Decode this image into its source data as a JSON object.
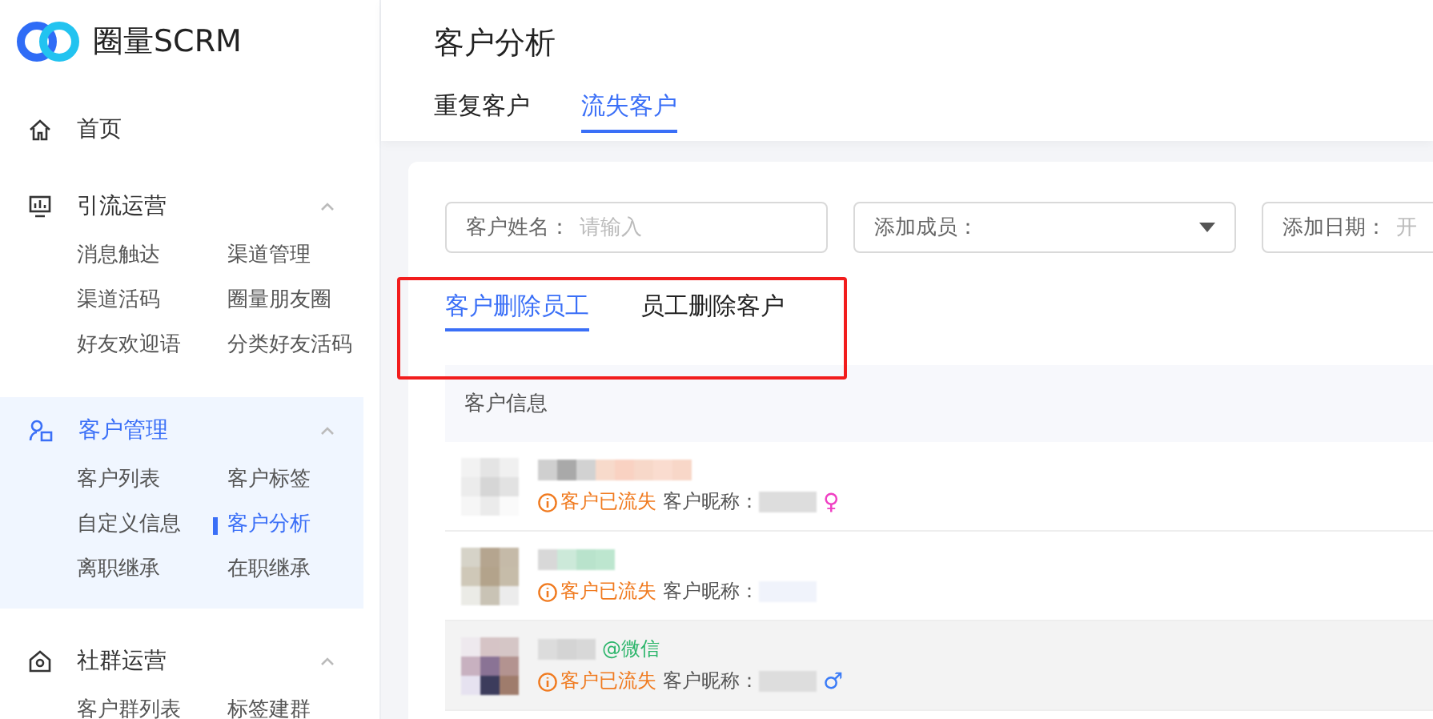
{
  "brand": {
    "name": "圈量SCRM"
  },
  "sidebar": {
    "groups": [
      {
        "label": "首页",
        "selected": false
      },
      {
        "label": "引流运营",
        "expanded": true,
        "selected": false,
        "children": [
          {
            "label": "消息触达",
            "selected": false
          },
          {
            "label": "渠道管理",
            "selected": false
          },
          {
            "label": "渠道活码",
            "selected": false
          },
          {
            "label": "圈量朋友圈",
            "selected": false
          },
          {
            "label": "好友欢迎语",
            "selected": false
          },
          {
            "label": "分类好友活码",
            "selected": false
          }
        ]
      },
      {
        "label": "客户管理",
        "expanded": true,
        "selected": true,
        "children": [
          {
            "label": "客户列表",
            "selected": false
          },
          {
            "label": "客户标签",
            "selected": false
          },
          {
            "label": "自定义信息",
            "selected": false
          },
          {
            "label": "客户分析",
            "selected": true
          },
          {
            "label": "离职继承",
            "selected": false
          },
          {
            "label": "在职继承",
            "selected": false
          }
        ]
      },
      {
        "label": "社群运营",
        "expanded": true,
        "selected": false,
        "children": [
          {
            "label": "客户群列表",
            "selected": false
          },
          {
            "label": "标签建群",
            "selected": false
          }
        ]
      }
    ]
  },
  "page": {
    "title": "客户分析",
    "tabs": [
      {
        "label": "重复客户",
        "selected": false
      },
      {
        "label": "流失客户",
        "selected": true
      }
    ]
  },
  "filters": [
    {
      "kind": "input",
      "label": "客户姓名：",
      "placeholder": "请输入"
    },
    {
      "kind": "select",
      "label": "添加成员："
    },
    {
      "kind": "date",
      "label": "添加日期：",
      "placeholder": "开"
    }
  ],
  "sub_tabs": [
    {
      "label": "客户删除员工",
      "selected": true
    },
    {
      "label": "员工删除客户",
      "selected": false
    }
  ],
  "annotation": {
    "shown": true
  },
  "table": {
    "columns": [
      "客户信息"
    ],
    "rows": [
      {
        "hovered": false,
        "status": "客户已流失",
        "nickname_label": "客户昵称：",
        "gender": {
          "mark": "♀",
          "color": "#f03fc3"
        }
      },
      {
        "hovered": false,
        "status": "客户已流失",
        "nickname_label": "客户昵称："
      },
      {
        "hovered": true,
        "status": "客户已流失",
        "nickname_label": "客户昵称：",
        "gender": {
          "mark": "♂",
          "color": "#3a7bf7"
        },
        "tag": "@微信"
      }
    ]
  }
}
